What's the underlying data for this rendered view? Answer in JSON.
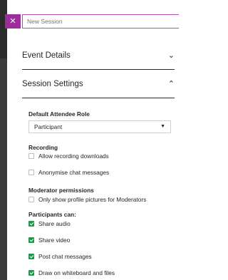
{
  "panel": {
    "close_icon": "×",
    "session_name_placeholder": "New Session"
  },
  "sections": {
    "event_details": {
      "label": "Event Details",
      "chevron": "⌄"
    },
    "session_settings": {
      "label": "Session Settings",
      "chevron": "⌃"
    }
  },
  "settings": {
    "default_role_label": "Default Attendee Role",
    "default_role_value": "Participant",
    "recording_label": "Recording",
    "allow_recording_downloads": {
      "label": "Allow recording downloads",
      "checked": false
    },
    "anonymise_chat": {
      "label": "Anonymise chat messages",
      "checked": false
    },
    "moderator_permissions_label": "Moderator permissions",
    "profile_pictures_moderators": {
      "label": "Only show profile pictures for Moderators",
      "checked": false
    },
    "participants_can_label": "Participants can:",
    "share_audio": {
      "label": "Share audio",
      "checked": true
    },
    "share_video": {
      "label": "Share video",
      "checked": true
    },
    "post_chat_messages": {
      "label": "Post chat messages",
      "checked": true
    },
    "draw_whiteboard": {
      "label": "Draw on whiteboard and files",
      "checked": true
    }
  },
  "colors": {
    "accent": "#9d2d9d",
    "input_border": "#b44fb4",
    "checked": "#1f9a4b"
  }
}
